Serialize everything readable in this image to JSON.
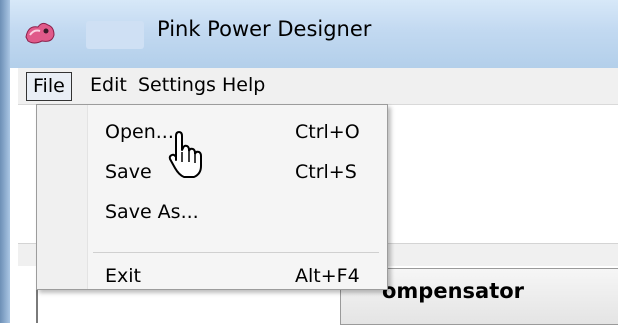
{
  "window": {
    "title": "Pink Power Designer",
    "icon": "pink-power-app-icon"
  },
  "menubar": {
    "items": [
      "File",
      "Edit",
      "Settings",
      "Help"
    ],
    "active": "File"
  },
  "file_menu": {
    "items": [
      {
        "label": "Open...",
        "shortcut": "Ctrl+O"
      },
      {
        "label": "Save",
        "shortcut": "Ctrl+S"
      },
      {
        "label": "Save As...",
        "shortcut": ""
      },
      {
        "label": "Exit",
        "shortcut": "Alt+F4"
      }
    ]
  },
  "background": {
    "tab_label": "ompensator"
  },
  "cursor": "hand-pointer-cursor",
  "colors": {
    "title_gradient_top": "#d7e8f8",
    "title_gradient_bottom": "#b3cfea",
    "menu_bg": "#f0f0f0",
    "dropdown_bg": "#f5f5f5"
  }
}
